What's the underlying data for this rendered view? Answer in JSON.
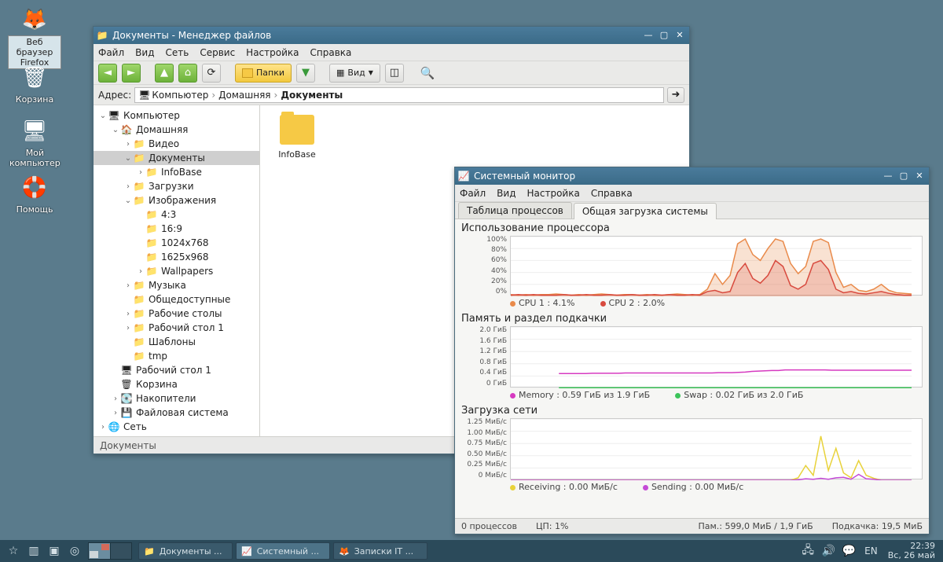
{
  "desktop": {
    "icons": [
      {
        "name": "firefox",
        "label": "Веб браузер\nFirefox",
        "selected": true
      },
      {
        "name": "trash",
        "label": "Корзина"
      },
      {
        "name": "computer",
        "label": "Мой\nкомпьютер"
      },
      {
        "name": "help",
        "label": "Помощь"
      }
    ]
  },
  "fm": {
    "title": "Документы - Менеджер файлов",
    "menu": [
      "Файл",
      "Вид",
      "Сеть",
      "Сервис",
      "Настройка",
      "Справка"
    ],
    "toolbar": {
      "folders_label": "Папки",
      "view_label": "Вид"
    },
    "address_label": "Адрес:",
    "breadcrumb": [
      "Компьютер",
      "Домашняя",
      "Документы"
    ],
    "tree": [
      {
        "d": 0,
        "tw": "v",
        "icon": "computer",
        "label": "Компьютер"
      },
      {
        "d": 1,
        "tw": "v",
        "icon": "home",
        "label": "Домашняя"
      },
      {
        "d": 2,
        "tw": ">",
        "icon": "folder",
        "label": "Видео"
      },
      {
        "d": 2,
        "tw": "v",
        "icon": "folder",
        "label": "Документы",
        "sel": true
      },
      {
        "d": 3,
        "tw": ">",
        "icon": "folder",
        "label": "InfoBase"
      },
      {
        "d": 2,
        "tw": ">",
        "icon": "folder",
        "label": "Загрузки"
      },
      {
        "d": 2,
        "tw": "v",
        "icon": "folder",
        "label": "Изображения"
      },
      {
        "d": 3,
        "tw": "",
        "icon": "folder",
        "label": "4:3"
      },
      {
        "d": 3,
        "tw": "",
        "icon": "folder",
        "label": "16:9"
      },
      {
        "d": 3,
        "tw": "",
        "icon": "folder",
        "label": "1024x768"
      },
      {
        "d": 3,
        "tw": "",
        "icon": "folder",
        "label": "1625x968"
      },
      {
        "d": 3,
        "tw": ">",
        "icon": "folder",
        "label": "Wallpapers"
      },
      {
        "d": 2,
        "tw": ">",
        "icon": "folder",
        "label": "Музыка"
      },
      {
        "d": 2,
        "tw": "",
        "icon": "folder",
        "label": "Общедоступные"
      },
      {
        "d": 2,
        "tw": ">",
        "icon": "folder",
        "label": "Рабочие столы"
      },
      {
        "d": 2,
        "tw": ">",
        "icon": "folder",
        "label": "Рабочий стол 1"
      },
      {
        "d": 2,
        "tw": "",
        "icon": "folder",
        "label": "Шаблоны"
      },
      {
        "d": 2,
        "tw": "",
        "icon": "folder",
        "label": "tmp"
      },
      {
        "d": 1,
        "tw": "",
        "icon": "desktop",
        "label": "Рабочий стол 1"
      },
      {
        "d": 1,
        "tw": "",
        "icon": "trash",
        "label": "Корзина"
      },
      {
        "d": 1,
        "tw": ">",
        "icon": "drives",
        "label": "Накопители"
      },
      {
        "d": 1,
        "tw": ">",
        "icon": "fs",
        "label": "Файловая система"
      },
      {
        "d": 0,
        "tw": ">",
        "icon": "network",
        "label": "Сеть"
      }
    ],
    "items": [
      {
        "label": "InfoBase"
      }
    ],
    "status": "Документы"
  },
  "sm": {
    "title": "Системный монитор",
    "menu": [
      "Файл",
      "Вид",
      "Настройка",
      "Справка"
    ],
    "tabs": [
      "Таблица процессов",
      "Общая загрузка системы"
    ],
    "active_tab": 1,
    "cpu": {
      "title": "Использование процессора",
      "legend": [
        {
          "c": "#e98a4a",
          "t": "CPU 1 : 4.1%"
        },
        {
          "c": "#d84a3e",
          "t": "CPU 2 : 2.0%"
        }
      ]
    },
    "mem": {
      "title": "Память и раздел подкачки",
      "legend": [
        {
          "c": "#d63ac0",
          "t": "Memory : 0.59 ГиБ из 1.9 ГиБ"
        },
        {
          "c": "#3cc45a",
          "t": "Swap : 0.02 ГиБ из 2.0 ГиБ"
        }
      ]
    },
    "net": {
      "title": "Загрузка сети",
      "legend": [
        {
          "c": "#e8d23a",
          "t": "Receiving : 0.00 МиБ/с"
        },
        {
          "c": "#c44ad6",
          "t": "Sending : 0.00 МиБ/с"
        }
      ]
    },
    "status": {
      "processes": "0 процессов",
      "cpu": "ЦП: 1%",
      "mem": "Пам.: 599,0 МиБ / 1,9 ГиБ",
      "swap": "Подкачка: 19,5 МиБ"
    }
  },
  "taskbar": {
    "tasks": [
      {
        "icon": "fm",
        "label": "Документы ...",
        "active": false
      },
      {
        "icon": "sm",
        "label": "Системный ...",
        "active": true
      },
      {
        "icon": "ff",
        "label": "Записки IT ...",
        "active": false
      }
    ],
    "lang": "EN",
    "time": "22:39",
    "date": "Вс, 26 май"
  },
  "chart_data": [
    {
      "type": "line",
      "title": "Использование процессора",
      "ylabel": "%",
      "ylim": [
        0,
        100
      ],
      "yticks": [
        "100%",
        "80%",
        "60%",
        "40%",
        "20%",
        "0%"
      ],
      "series": [
        {
          "name": "CPU 1",
          "color": "#e98a4a",
          "fill": "rgba(233,138,74,.25)",
          "values": [
            3,
            2,
            3,
            2,
            3,
            3,
            4,
            3,
            2,
            3,
            2,
            3,
            4,
            3,
            2,
            3,
            3,
            2,
            3,
            2,
            2,
            3,
            4,
            3,
            2,
            3,
            12,
            38,
            20,
            35,
            88,
            96,
            70,
            60,
            80,
            96,
            92,
            55,
            38,
            50,
            92,
            96,
            90,
            40,
            15,
            20,
            10,
            8,
            12,
            20,
            10,
            6,
            5,
            4
          ]
        },
        {
          "name": "CPU 2",
          "color": "#d84a3e",
          "fill": "rgba(216,74,62,.2)",
          "values": [
            2,
            3,
            2,
            3,
            2,
            2,
            2,
            3,
            2,
            2,
            3,
            2,
            2,
            3,
            2,
            2,
            3,
            2,
            2,
            3,
            2,
            3,
            2,
            2,
            3,
            2,
            8,
            10,
            6,
            8,
            40,
            55,
            30,
            22,
            35,
            60,
            50,
            18,
            12,
            20,
            55,
            60,
            45,
            12,
            6,
            8,
            5,
            4,
            6,
            8,
            5,
            3,
            2,
            2
          ]
        }
      ]
    },
    {
      "type": "line",
      "title": "Память и раздел подкачки",
      "ylabel": "ГиБ",
      "ylim": [
        0,
        2.0
      ],
      "yticks": [
        "2.0 ГиБ",
        "1.6 ГиБ",
        "1.2 ГиБ",
        "0.8 ГиБ",
        "0.4 ГиБ",
        "0 ГиБ"
      ],
      "series": [
        {
          "name": "Memory",
          "color": "#d63ac0",
          "values": [
            0.48,
            0.48,
            0.48,
            0.48,
            0.48,
            0.49,
            0.49,
            0.49,
            0.49,
            0.49,
            0.5,
            0.5,
            0.5,
            0.5,
            0.5,
            0.5,
            0.5,
            0.5,
            0.5,
            0.5,
            0.5,
            0.5,
            0.5,
            0.5,
            0.51,
            0.51,
            0.51,
            0.52,
            0.53,
            0.55,
            0.56,
            0.57,
            0.58,
            0.58,
            0.6,
            0.6,
            0.6,
            0.6,
            0.6,
            0.6,
            0.6,
            0.59,
            0.59,
            0.59,
            0.59,
            0.59,
            0.59,
            0.59,
            0.59,
            0.59,
            0.59,
            0.59,
            0.59,
            0.59
          ]
        },
        {
          "name": "Swap",
          "color": "#3cc45a",
          "values": [
            0.02,
            0.02,
            0.02,
            0.02,
            0.02,
            0.02,
            0.02,
            0.02,
            0.02,
            0.02,
            0.02,
            0.02,
            0.02,
            0.02,
            0.02,
            0.02,
            0.02,
            0.02,
            0.02,
            0.02,
            0.02,
            0.02,
            0.02,
            0.02,
            0.02,
            0.02,
            0.02,
            0.02,
            0.02,
            0.02,
            0.02,
            0.02,
            0.02,
            0.02,
            0.02,
            0.02,
            0.02,
            0.02,
            0.02,
            0.02,
            0.02,
            0.02,
            0.02,
            0.02,
            0.02,
            0.02,
            0.02,
            0.02,
            0.02,
            0.02,
            0.02,
            0.02,
            0.02,
            0.02
          ]
        }
      ]
    },
    {
      "type": "line",
      "title": "Загрузка сети",
      "ylabel": "МиБ/с",
      "ylim": [
        0,
        1.25
      ],
      "yticks": [
        "1.25 МиБ/с",
        "1.00 МиБ/с",
        "0.75 МиБ/с",
        "0.50 МиБ/с",
        "0.25 МиБ/с",
        "0 МиБ/с"
      ],
      "series": [
        {
          "name": "Receiving",
          "color": "#e8d23a",
          "values": [
            0,
            0,
            0,
            0,
            0,
            0,
            0,
            0,
            0,
            0,
            0,
            0,
            0,
            0,
            0,
            0,
            0,
            0,
            0,
            0,
            0,
            0,
            0,
            0,
            0,
            0,
            0,
            0,
            0,
            0,
            0,
            0,
            0,
            0,
            0,
            0,
            0,
            0,
            0.05,
            0.3,
            0.1,
            0.9,
            0.2,
            0.65,
            0.15,
            0.05,
            0.4,
            0.1,
            0.04,
            0,
            0,
            0,
            0,
            0
          ]
        },
        {
          "name": "Sending",
          "color": "#c44ad6",
          "values": [
            0,
            0,
            0,
            0,
            0,
            0,
            0,
            0,
            0,
            0,
            0,
            0,
            0,
            0,
            0,
            0,
            0,
            0,
            0,
            0,
            0,
            0,
            0,
            0,
            0,
            0,
            0,
            0,
            0,
            0,
            0,
            0,
            0,
            0,
            0,
            0,
            0,
            0,
            0.01,
            0.03,
            0.02,
            0.04,
            0.02,
            0.05,
            0.06,
            0.02,
            0.12,
            0.03,
            0.02,
            0,
            0,
            0,
            0,
            0
          ]
        }
      ]
    }
  ]
}
